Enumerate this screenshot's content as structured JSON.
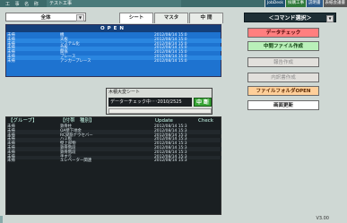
{
  "topbar": {
    "label": "工 事 名 称",
    "title": "テスト工事",
    "tabs": [
      "JobDesk",
      "採購工事",
      "説明書",
      "表紙会議書"
    ]
  },
  "dept_select": {
    "value": "全体"
  },
  "view_tabs": [
    "シート",
    "マスタ",
    "中 間"
  ],
  "open_panel": {
    "header": "OPEN",
    "rows": [
      {
        "c1": "未掃",
        "c2": "機",
        "c3": "2012/08/14 15:0"
      },
      {
        "c1": "未掃",
        "c2": "天板",
        "c3": "2012/08/14 15:0"
      },
      {
        "c1": "未掃",
        "c2": "システム化",
        "c3": "2012/08/14 15:0"
      },
      {
        "c1": "未掃",
        "c2": "合板",
        "c3": "2012/08/14 15:0"
      },
      {
        "c1": "未掃",
        "c2": "関係",
        "c3": "2012/08/14 15:0"
      },
      {
        "c1": "未掃",
        "c2": "ブレース",
        "c3": "2012/08/14 15:0"
      },
      {
        "c1": "未掃",
        "c2": "アンカープレース",
        "c3": "2012/08/14 15:0"
      }
    ]
  },
  "group_panel": {
    "header_group": "【グループ】",
    "header_item": "【付帯　種別】",
    "header_update": "Update",
    "header_check": "Check",
    "rows": [
      {
        "c1": "未掃",
        "c2": "鉄骨柱",
        "c3": "2012/08/14 15:3"
      },
      {
        "c1": "未掃",
        "c2": "OA壁下地金",
        "c3": "2012/08/14 15:3"
      },
      {
        "c1": "未掃",
        "c2": "RC梁筋ナウセバー",
        "c3": "2012/08/14 15:3"
      },
      {
        "c1": "未掃",
        "c2": "ハミ板",
        "c3": "2012/08/14 15:3"
      },
      {
        "c1": "未掃",
        "c2": "壁上部物",
        "c3": "2012/08/14 15:3"
      },
      {
        "c1": "未掃",
        "c2": "鉄骨階段",
        "c3": "2012/08/14 15:3"
      },
      {
        "c1": "未掃",
        "c2": "鉄骨階段",
        "c3": "2012/08/14 15:3"
      },
      {
        "c1": "未掃",
        "c2": "手すり",
        "c3": "2012/08/14 15:3"
      },
      {
        "c1": "未掃",
        "c2": "エレベーター関連",
        "c3": "2012/08/14 15:3"
      }
    ]
  },
  "command": {
    "header": "＜コマンド選択＞",
    "buttons": [
      "データチェック",
      "中間ファイル作成",
      "報告作成",
      "内訳書作成",
      "ファイルフォルダOPEN",
      "画面更新"
    ]
  },
  "dialog": {
    "title": "木積大変シート",
    "message": "データーチェック中･･･2010/2525",
    "cancel_label": "中 断"
  },
  "version": "V3.00",
  "colors": {
    "open_panel": "#1e73d0",
    "group_panel": "#1a1f22",
    "btn_check": "#ff7f7f",
    "btn_middle": "#b9f0b9",
    "btn_folder": "#ffcf9a"
  }
}
